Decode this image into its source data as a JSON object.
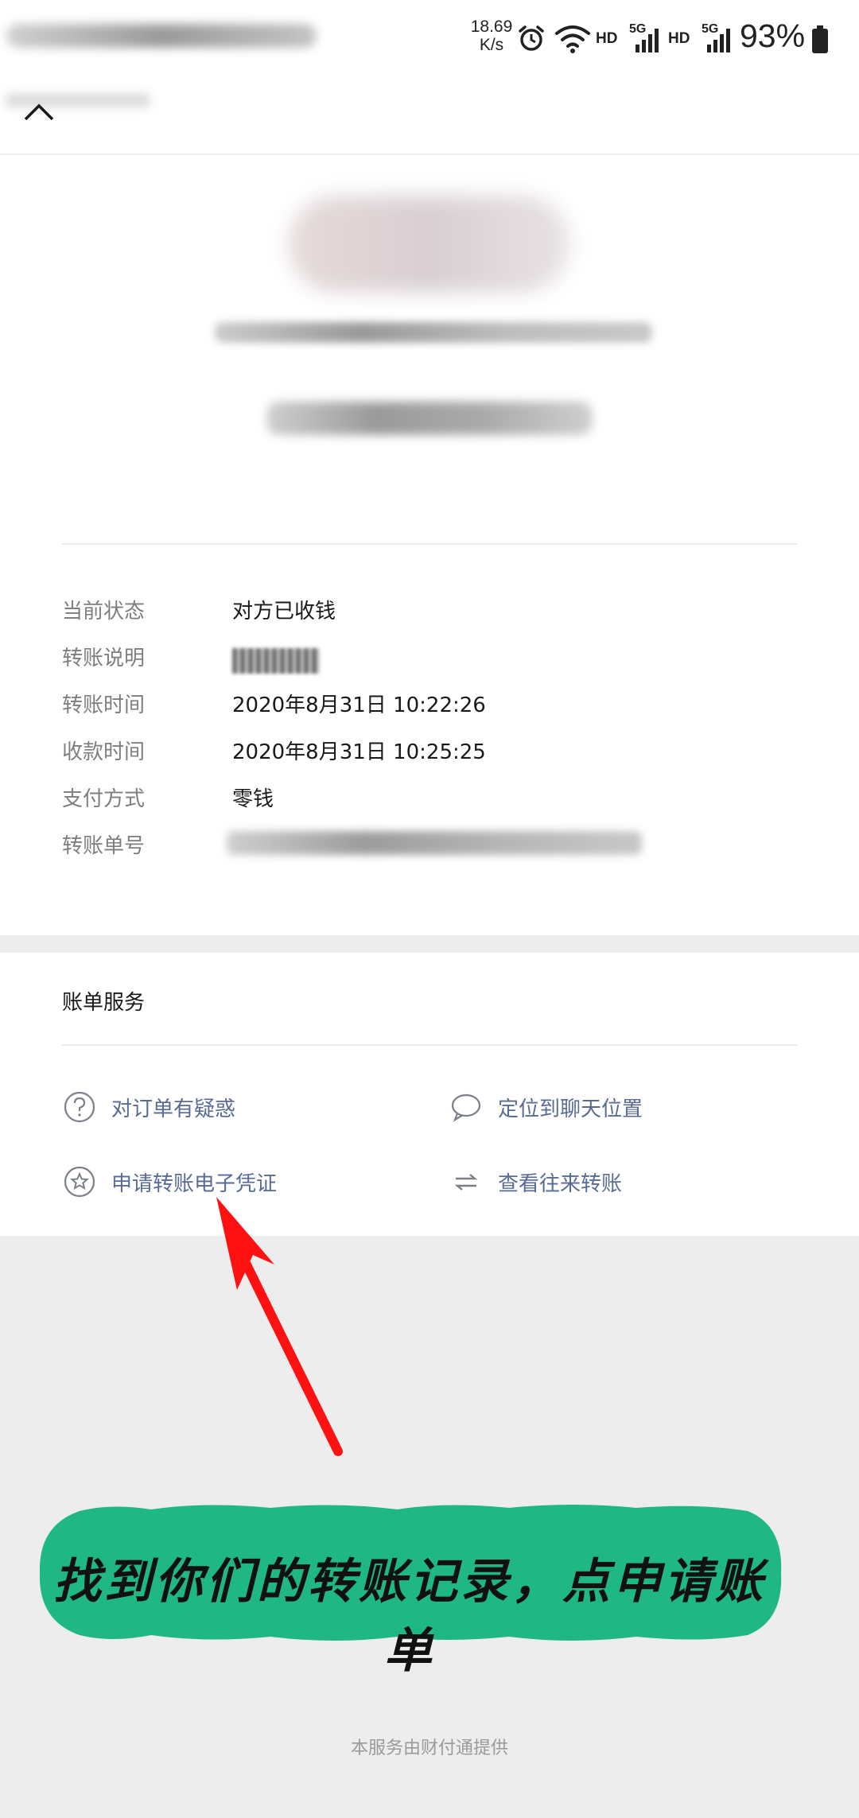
{
  "status_bar": {
    "net_speed_value": "18.69",
    "net_speed_unit": "K/s",
    "hd_label_1": "HD",
    "hd_label_2": "HD",
    "signal_label_1": "5G",
    "signal_label_2": "5G",
    "battery_percent": "93%",
    "icons": [
      "alarm-icon",
      "wifi-icon",
      "signal-icon",
      "battery-icon"
    ]
  },
  "details": {
    "rows": [
      {
        "label": "当前状态",
        "value": "对方已收钱"
      },
      {
        "label": "转账说明",
        "value": ""
      },
      {
        "label": "转账时间",
        "value": "2020年8月31日 10:22:26"
      },
      {
        "label": "收款时间",
        "value": "2020年8月31日 10:25:25"
      },
      {
        "label": "支付方式",
        "value": "零钱"
      },
      {
        "label": "转账单号",
        "value": ""
      }
    ]
  },
  "bill_service": {
    "title": "账单服务",
    "items": [
      {
        "label": "对订单有疑惑",
        "icon": "question-circle-icon"
      },
      {
        "label": "定位到聊天位置",
        "icon": "chat-bubble-icon"
      },
      {
        "label": "申请转账电子凭证",
        "icon": "star-badge-icon"
      },
      {
        "label": "查看往来转账",
        "icon": "swap-arrows-icon"
      }
    ]
  },
  "annotation": {
    "banner_text": "找到你们的转账记录，点申请账单",
    "banner_color": "#1fb885",
    "arrow_color": "#ff1111"
  },
  "footer": {
    "text": "本服务由财付通提供"
  },
  "colors": {
    "link_blue": "#576b95",
    "label_grey": "#7e7e7e",
    "background_grey": "#ededed"
  }
}
